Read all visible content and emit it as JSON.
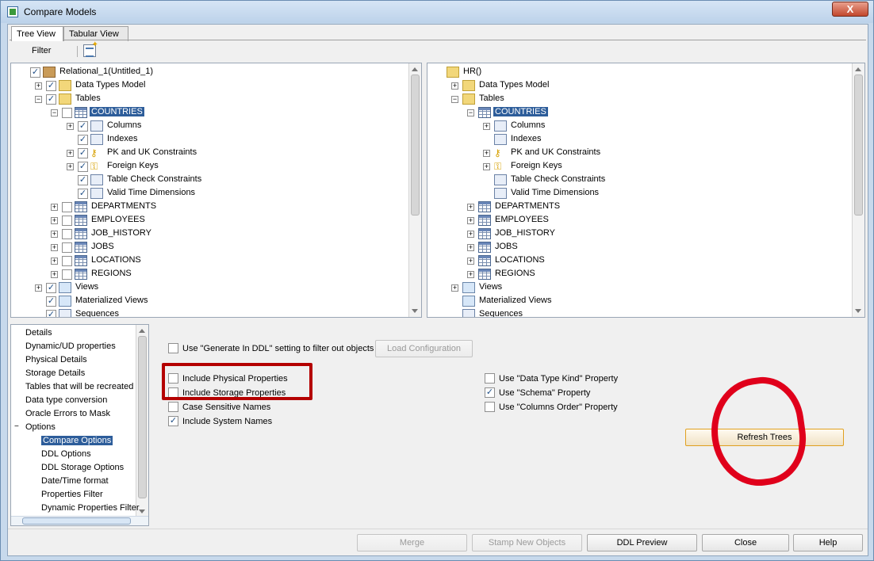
{
  "window": {
    "title": "Compare Models",
    "close_symbol": "X"
  },
  "tabs": [
    {
      "label": "Tree View",
      "active": true
    },
    {
      "label": "Tabular View",
      "active": false
    }
  ],
  "toolbar": {
    "filter_label": "Filter"
  },
  "left_tree": [
    {
      "label": "Relational_1(Untitled_1)",
      "level": 0,
      "expander": "",
      "checked": true,
      "icon": "cube-icon"
    },
    {
      "label": "Data Types Model",
      "level": 1,
      "expander": "+",
      "checked": true,
      "icon": "folder-icon"
    },
    {
      "label": "Tables",
      "level": 1,
      "expander": "-",
      "checked": true,
      "icon": "folder-icon"
    },
    {
      "label": "COUNTRIES",
      "level": 2,
      "expander": "-",
      "checked": false,
      "icon": "table-icon",
      "selected": true
    },
    {
      "label": "Columns",
      "level": 3,
      "expander": "+",
      "checked": true,
      "icon": "columns-icon"
    },
    {
      "label": "Indexes",
      "level": 3,
      "expander": "",
      "checked": true,
      "icon": "index-icon"
    },
    {
      "label": "PK and UK Constraints",
      "level": 3,
      "expander": "+",
      "checked": true,
      "icon": "key-icon"
    },
    {
      "label": "Foreign Keys",
      "level": 3,
      "expander": "+",
      "checked": true,
      "icon": "foreign-key-icon"
    },
    {
      "label": "Table Check Constraints",
      "level": 3,
      "expander": "",
      "checked": true,
      "icon": "constraint-icon"
    },
    {
      "label": "Valid Time Dimensions",
      "level": 3,
      "expander": "",
      "checked": true,
      "icon": "time-icon"
    },
    {
      "label": "DEPARTMENTS",
      "level": 2,
      "expander": "+",
      "checked": false,
      "icon": "table-icon"
    },
    {
      "label": "EMPLOYEES",
      "level": 2,
      "expander": "+",
      "checked": false,
      "icon": "table-icon"
    },
    {
      "label": "JOB_HISTORY",
      "level": 2,
      "expander": "+",
      "checked": false,
      "icon": "table-icon"
    },
    {
      "label": "JOBS",
      "level": 2,
      "expander": "+",
      "checked": false,
      "icon": "table-icon"
    },
    {
      "label": "LOCATIONS",
      "level": 2,
      "expander": "+",
      "checked": false,
      "icon": "table-icon"
    },
    {
      "label": "REGIONS",
      "level": 2,
      "expander": "+",
      "checked": false,
      "icon": "table-icon"
    },
    {
      "label": "Views",
      "level": 1,
      "expander": "+",
      "checked": true,
      "icon": "view-icon"
    },
    {
      "label": "Materialized Views",
      "level": 1,
      "expander": "",
      "checked": true,
      "icon": "materialized-view-icon"
    },
    {
      "label": "Sequences",
      "level": 1,
      "expander": "",
      "checked": true,
      "icon": "sequence-icon"
    }
  ],
  "right_tree": [
    {
      "label": "HR()",
      "level": 0,
      "expander": "",
      "icon": "folder-open-icon"
    },
    {
      "label": "Data Types Model",
      "level": 1,
      "expander": "+",
      "icon": "folder-icon"
    },
    {
      "label": "Tables",
      "level": 1,
      "expander": "-",
      "icon": "folder-icon"
    },
    {
      "label": "COUNTRIES",
      "level": 2,
      "expander": "-",
      "icon": "table-icon",
      "selected": true
    },
    {
      "label": "Columns",
      "level": 3,
      "expander": "+",
      "icon": "columns-icon"
    },
    {
      "label": "Indexes",
      "level": 3,
      "expander": "",
      "icon": "index-icon"
    },
    {
      "label": "PK and UK Constraints",
      "level": 3,
      "expander": "+",
      "icon": "key-icon"
    },
    {
      "label": "Foreign Keys",
      "level": 3,
      "expander": "+",
      "icon": "foreign-key-icon"
    },
    {
      "label": "Table Check Constraints",
      "level": 3,
      "expander": "",
      "icon": "constraint-icon"
    },
    {
      "label": "Valid Time Dimensions",
      "level": 3,
      "expander": "",
      "icon": "time-icon"
    },
    {
      "label": "DEPARTMENTS",
      "level": 2,
      "expander": "+",
      "icon": "table-icon"
    },
    {
      "label": "EMPLOYEES",
      "level": 2,
      "expander": "+",
      "icon": "table-icon"
    },
    {
      "label": "JOB_HISTORY",
      "level": 2,
      "expander": "+",
      "icon": "table-icon"
    },
    {
      "label": "JOBS",
      "level": 2,
      "expander": "+",
      "icon": "table-icon"
    },
    {
      "label": "LOCATIONS",
      "level": 2,
      "expander": "+",
      "icon": "table-icon"
    },
    {
      "label": "REGIONS",
      "level": 2,
      "expander": "+",
      "icon": "table-icon"
    },
    {
      "label": "Views",
      "level": 1,
      "expander": "+",
      "icon": "view-icon"
    },
    {
      "label": "Materialized Views",
      "level": 1,
      "expander": "",
      "icon": "materialized-view-icon"
    },
    {
      "label": "Sequences",
      "level": 1,
      "expander": "",
      "icon": "sequence-icon"
    }
  ],
  "details_tree": [
    {
      "label": "Details",
      "level": 0
    },
    {
      "label": "Dynamic/UD properties",
      "level": 0
    },
    {
      "label": "Physical Details",
      "level": 0
    },
    {
      "label": "Storage Details",
      "level": 0
    },
    {
      "label": "Tables that will be recreated",
      "level": 0
    },
    {
      "label": "Data type conversion",
      "level": 0
    },
    {
      "label": "Oracle Errors to Mask",
      "level": 0
    },
    {
      "label": "Options",
      "level": 0,
      "expander": "-"
    },
    {
      "label": "Compare Options",
      "level": 1,
      "selected": true
    },
    {
      "label": "DDL Options",
      "level": 1
    },
    {
      "label": "DDL Storage Options",
      "level": 1
    },
    {
      "label": "Date/Time format",
      "level": 1
    },
    {
      "label": "Properties Filter",
      "level": 1
    },
    {
      "label": "Dynamic Properties Filter",
      "level": 1
    }
  ],
  "options": {
    "generate_in_ddl": {
      "label": "Use \"Generate In DDL\" setting to filter out objects",
      "checked": false
    },
    "load_configuration": "Load Configuration",
    "left_checks": [
      {
        "label": "Include Physical Properties",
        "checked": false
      },
      {
        "label": "Include Storage Properties",
        "checked": false
      },
      {
        "label": "Case Sensitive Names",
        "checked": false
      },
      {
        "label": "Include System Names",
        "checked": true
      }
    ],
    "right_checks": [
      {
        "label": "Use \"Data Type Kind\" Property",
        "checked": false
      },
      {
        "label": "Use \"Schema\" Property",
        "checked": true
      },
      {
        "label": "Use \"Columns Order\" Property",
        "checked": false
      }
    ],
    "refresh_trees": "Refresh Trees"
  },
  "buttons": {
    "merge": "Merge",
    "stamp_new_objects": "Stamp New Objects",
    "ddl_preview": "DDL Preview",
    "close": "Close",
    "help": "Help"
  }
}
